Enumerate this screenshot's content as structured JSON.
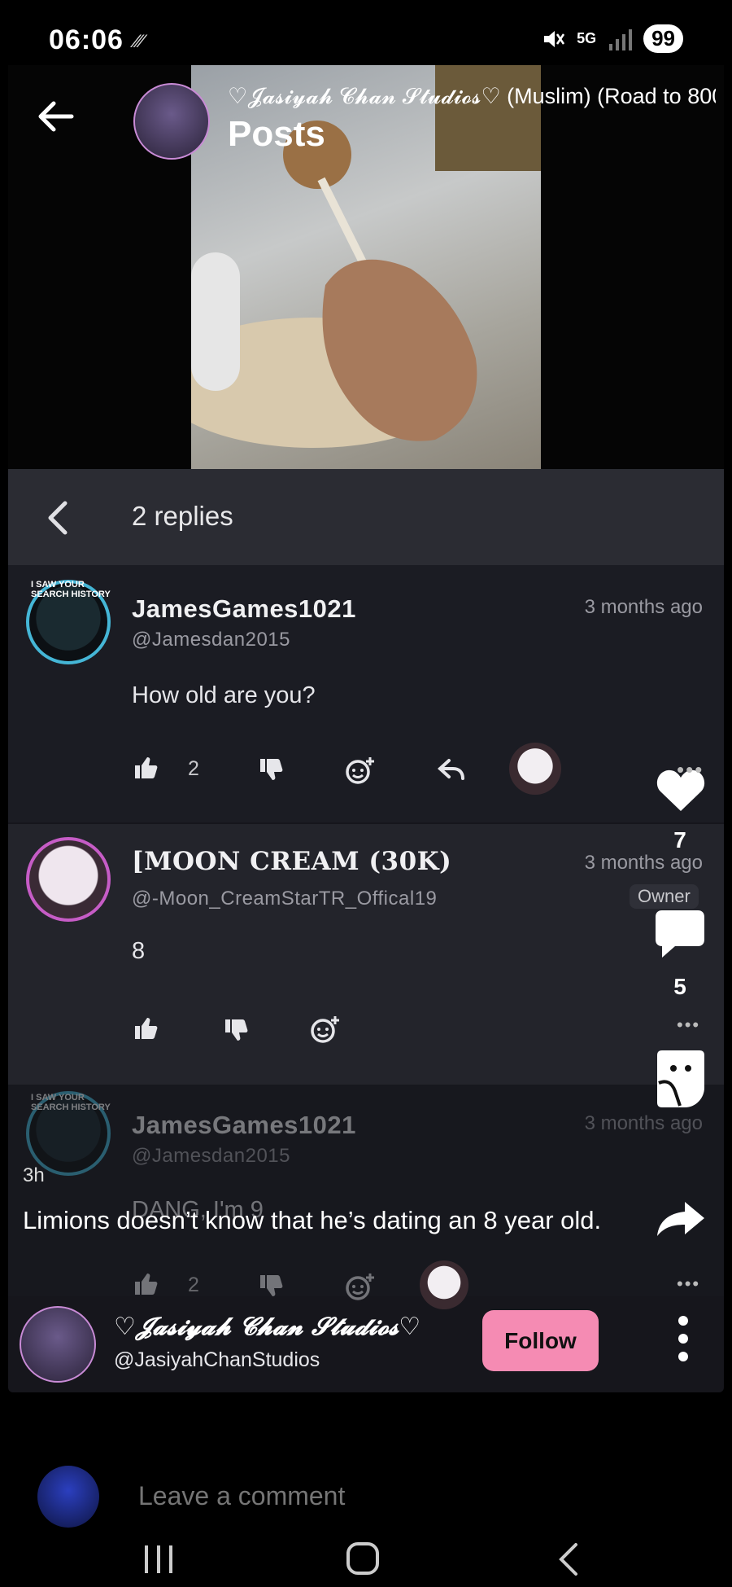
{
  "status_bar": {
    "time": "06:06",
    "extra": "⁄⁄⁄",
    "network": "5G",
    "battery": "99"
  },
  "header": {
    "community_title": "♡𝓙𝓪𝓼𝓲𝔂𝓪𝓱 𝓒𝓱𝓪𝓷 𝓢𝓽𝓾𝓭𝓲𝓸𝓼♡ (Muslim) (Road to 800",
    "section": "Posts"
  },
  "replies": {
    "count_label": "2 replies"
  },
  "comments": [
    {
      "name": "JamesGames1021",
      "handle": "@Jamesdan2015",
      "time": "3 months ago",
      "text": "How old are you?",
      "likes": "2",
      "badge": "I SAW YOUR SEARCH HISTORY"
    },
    {
      "name": "[MOON CREAM (30K)",
      "handle": "@-Moon_CreamStarTR_Offical19",
      "time": "3 months ago",
      "text": "8",
      "role": "Owner"
    },
    {
      "name": "JamesGames1021",
      "handle": "@Jamesdan2015",
      "time": "3 months ago",
      "text": "DANG, I'm 9",
      "likes": "2",
      "badge": "I SAW YOUR SEARCH HISTORY"
    }
  ],
  "side_actions": {
    "likes": "7",
    "comments": "5"
  },
  "caption": {
    "time": "3h",
    "text": "Limions doesn’t know that he’s dating an 8 year old."
  },
  "author": {
    "name": "♡𝓙𝓪𝓼𝓲𝔂𝓪𝓱 𝓒𝓱𝓪𝓷 𝓢𝓽𝓾𝓭𝓲𝓸𝓼♡",
    "handle": "@JasiyahChanStudios",
    "follow_label": "Follow"
  },
  "comment_box": {
    "placeholder": "Leave a comment"
  },
  "colors": {
    "accent_pink": "#f58bb3",
    "panel": "#1b1c23",
    "replies_bar": "#2b2c33"
  }
}
